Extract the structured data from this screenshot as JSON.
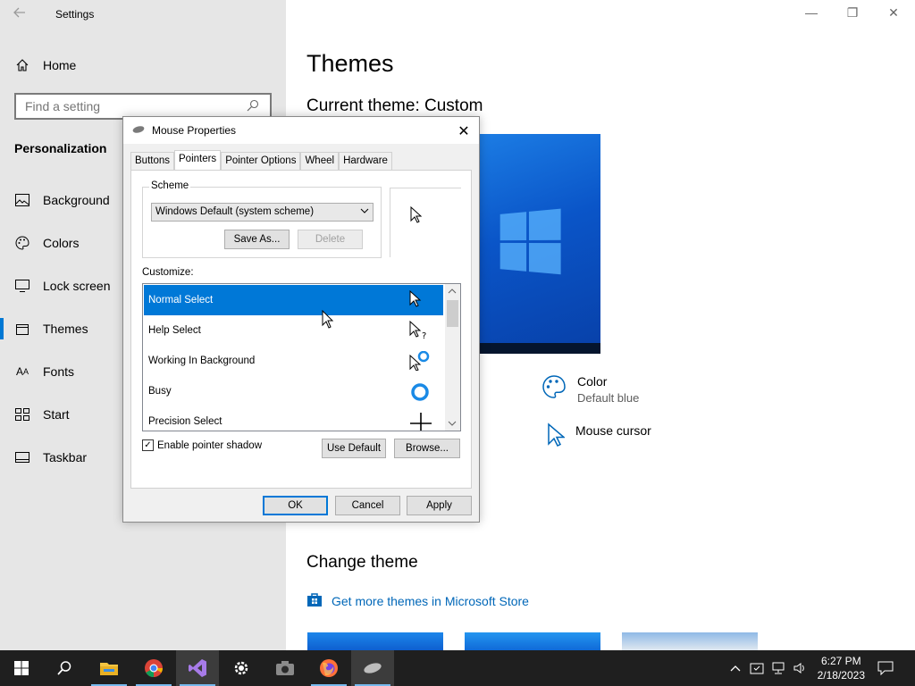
{
  "window": {
    "title": "Settings",
    "controls": {
      "minimize": "—",
      "maximize": "❐",
      "close": "✕"
    }
  },
  "sidebar": {
    "home_label": "Home",
    "search_placeholder": "Find a setting",
    "section_title": "Personalization",
    "items": [
      {
        "label": "Background",
        "icon": "image-icon"
      },
      {
        "label": "Colors",
        "icon": "palette-icon"
      },
      {
        "label": "Lock screen",
        "icon": "monitor-icon"
      },
      {
        "label": "Themes",
        "icon": "brush-icon",
        "active": true
      },
      {
        "label": "Fonts",
        "icon": "font-icon"
      },
      {
        "label": "Start",
        "icon": "start-icon"
      },
      {
        "label": "Taskbar",
        "icon": "taskbar-icon"
      }
    ]
  },
  "main": {
    "title": "Themes",
    "current_theme": "Current theme: Custom",
    "color": {
      "label": "Color",
      "value": "Default blue"
    },
    "mouse_cursor": {
      "label": "Mouse cursor"
    },
    "change_theme": "Change theme",
    "store_link": "Get more themes in Microsoft Store"
  },
  "dialog": {
    "title": "Mouse Properties",
    "close": "✕",
    "tabs": [
      "Buttons",
      "Pointers",
      "Pointer Options",
      "Wheel",
      "Hardware"
    ],
    "active_tab": "Pointers",
    "scheme_label": "Scheme",
    "scheme_value": "Windows Default (system scheme)",
    "save_as": "Save As...",
    "delete": "Delete",
    "customize_label": "Customize:",
    "cursors": [
      {
        "label": "Normal Select",
        "icon": "arrow-cursor-icon",
        "selected": true
      },
      {
        "label": "Help Select",
        "icon": "help-cursor-icon"
      },
      {
        "label": "Working In Background",
        "icon": "working-cursor-icon"
      },
      {
        "label": "Busy",
        "icon": "busy-cursor-icon"
      },
      {
        "label": "Precision Select",
        "icon": "crosshair-cursor-icon"
      }
    ],
    "enable_shadow": "Enable pointer shadow",
    "shadow_checked": true,
    "use_default": "Use Default",
    "browse": "Browse...",
    "ok": "OK",
    "cancel": "Cancel",
    "apply": "Apply"
  },
  "taskbar": {
    "time": "6:27 PM",
    "date": "2/18/2023",
    "apps": [
      "windows-start-icon",
      "search-icon",
      "file-explorer-icon",
      "chrome-icon",
      "visual-studio-icon",
      "settings-gear-icon",
      "camera-icon",
      "firefox-icon",
      "mouse-app-icon"
    ]
  },
  "colors": {
    "accent": "#0078d7",
    "link": "#0067b8",
    "taskbar": "#1f1f1f",
    "sidebar": "#e6e6e6"
  }
}
